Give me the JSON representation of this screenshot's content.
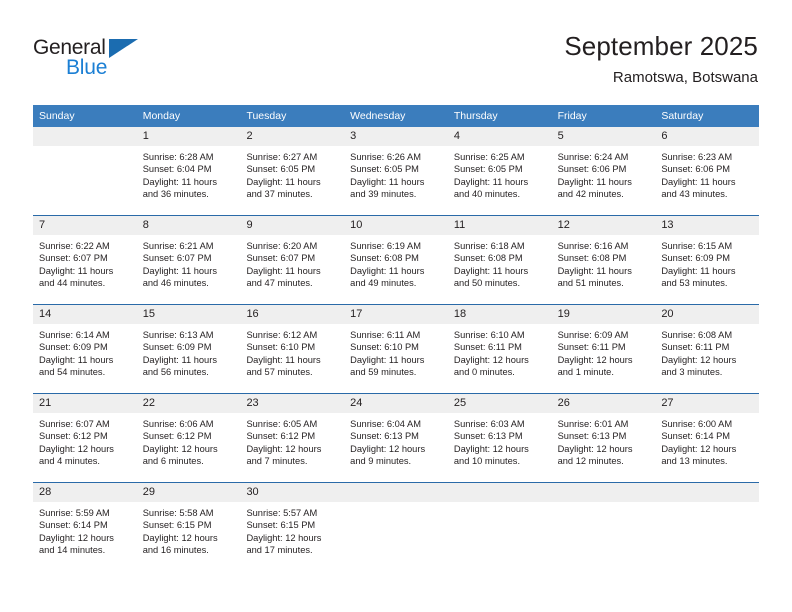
{
  "brand": {
    "name_dark": "General",
    "name_light": "Blue",
    "triangle_color": "#1b6cb0",
    "blue_color": "#1b7fd4"
  },
  "header": {
    "title": "September 2025",
    "subtitle": "Ramotswa, Botswana"
  },
  "calendar": {
    "header_bg": "#3b7dbd",
    "separator_color": "#2a6aa8",
    "daynum_bg": "#efefef",
    "weekdays": [
      "Sunday",
      "Monday",
      "Tuesday",
      "Wednesday",
      "Thursday",
      "Friday",
      "Saturday"
    ],
    "weeks": [
      [
        {
          "day": "",
          "l1": "",
          "l2": "",
          "l3": "",
          "l4": ""
        },
        {
          "day": "1",
          "l1": "Sunrise: 6:28 AM",
          "l2": "Sunset: 6:04 PM",
          "l3": "Daylight: 11 hours",
          "l4": "and 36 minutes."
        },
        {
          "day": "2",
          "l1": "Sunrise: 6:27 AM",
          "l2": "Sunset: 6:05 PM",
          "l3": "Daylight: 11 hours",
          "l4": "and 37 minutes."
        },
        {
          "day": "3",
          "l1": "Sunrise: 6:26 AM",
          "l2": "Sunset: 6:05 PM",
          "l3": "Daylight: 11 hours",
          "l4": "and 39 minutes."
        },
        {
          "day": "4",
          "l1": "Sunrise: 6:25 AM",
          "l2": "Sunset: 6:05 PM",
          "l3": "Daylight: 11 hours",
          "l4": "and 40 minutes."
        },
        {
          "day": "5",
          "l1": "Sunrise: 6:24 AM",
          "l2": "Sunset: 6:06 PM",
          "l3": "Daylight: 11 hours",
          "l4": "and 42 minutes."
        },
        {
          "day": "6",
          "l1": "Sunrise: 6:23 AM",
          "l2": "Sunset: 6:06 PM",
          "l3": "Daylight: 11 hours",
          "l4": "and 43 minutes."
        }
      ],
      [
        {
          "day": "7",
          "l1": "Sunrise: 6:22 AM",
          "l2": "Sunset: 6:07 PM",
          "l3": "Daylight: 11 hours",
          "l4": "and 44 minutes."
        },
        {
          "day": "8",
          "l1": "Sunrise: 6:21 AM",
          "l2": "Sunset: 6:07 PM",
          "l3": "Daylight: 11 hours",
          "l4": "and 46 minutes."
        },
        {
          "day": "9",
          "l1": "Sunrise: 6:20 AM",
          "l2": "Sunset: 6:07 PM",
          "l3": "Daylight: 11 hours",
          "l4": "and 47 minutes."
        },
        {
          "day": "10",
          "l1": "Sunrise: 6:19 AM",
          "l2": "Sunset: 6:08 PM",
          "l3": "Daylight: 11 hours",
          "l4": "and 49 minutes."
        },
        {
          "day": "11",
          "l1": "Sunrise: 6:18 AM",
          "l2": "Sunset: 6:08 PM",
          "l3": "Daylight: 11 hours",
          "l4": "and 50 minutes."
        },
        {
          "day": "12",
          "l1": "Sunrise: 6:16 AM",
          "l2": "Sunset: 6:08 PM",
          "l3": "Daylight: 11 hours",
          "l4": "and 51 minutes."
        },
        {
          "day": "13",
          "l1": "Sunrise: 6:15 AM",
          "l2": "Sunset: 6:09 PM",
          "l3": "Daylight: 11 hours",
          "l4": "and 53 minutes."
        }
      ],
      [
        {
          "day": "14",
          "l1": "Sunrise: 6:14 AM",
          "l2": "Sunset: 6:09 PM",
          "l3": "Daylight: 11 hours",
          "l4": "and 54 minutes."
        },
        {
          "day": "15",
          "l1": "Sunrise: 6:13 AM",
          "l2": "Sunset: 6:09 PM",
          "l3": "Daylight: 11 hours",
          "l4": "and 56 minutes."
        },
        {
          "day": "16",
          "l1": "Sunrise: 6:12 AM",
          "l2": "Sunset: 6:10 PM",
          "l3": "Daylight: 11 hours",
          "l4": "and 57 minutes."
        },
        {
          "day": "17",
          "l1": "Sunrise: 6:11 AM",
          "l2": "Sunset: 6:10 PM",
          "l3": "Daylight: 11 hours",
          "l4": "and 59 minutes."
        },
        {
          "day": "18",
          "l1": "Sunrise: 6:10 AM",
          "l2": "Sunset: 6:11 PM",
          "l3": "Daylight: 12 hours",
          "l4": "and 0 minutes."
        },
        {
          "day": "19",
          "l1": "Sunrise: 6:09 AM",
          "l2": "Sunset: 6:11 PM",
          "l3": "Daylight: 12 hours",
          "l4": "and 1 minute."
        },
        {
          "day": "20",
          "l1": "Sunrise: 6:08 AM",
          "l2": "Sunset: 6:11 PM",
          "l3": "Daylight: 12 hours",
          "l4": "and 3 minutes."
        }
      ],
      [
        {
          "day": "21",
          "l1": "Sunrise: 6:07 AM",
          "l2": "Sunset: 6:12 PM",
          "l3": "Daylight: 12 hours",
          "l4": "and 4 minutes."
        },
        {
          "day": "22",
          "l1": "Sunrise: 6:06 AM",
          "l2": "Sunset: 6:12 PM",
          "l3": "Daylight: 12 hours",
          "l4": "and 6 minutes."
        },
        {
          "day": "23",
          "l1": "Sunrise: 6:05 AM",
          "l2": "Sunset: 6:12 PM",
          "l3": "Daylight: 12 hours",
          "l4": "and 7 minutes."
        },
        {
          "day": "24",
          "l1": "Sunrise: 6:04 AM",
          "l2": "Sunset: 6:13 PM",
          "l3": "Daylight: 12 hours",
          "l4": "and 9 minutes."
        },
        {
          "day": "25",
          "l1": "Sunrise: 6:03 AM",
          "l2": "Sunset: 6:13 PM",
          "l3": "Daylight: 12 hours",
          "l4": "and 10 minutes."
        },
        {
          "day": "26",
          "l1": "Sunrise: 6:01 AM",
          "l2": "Sunset: 6:13 PM",
          "l3": "Daylight: 12 hours",
          "l4": "and 12 minutes."
        },
        {
          "day": "27",
          "l1": "Sunrise: 6:00 AM",
          "l2": "Sunset: 6:14 PM",
          "l3": "Daylight: 12 hours",
          "l4": "and 13 minutes."
        }
      ],
      [
        {
          "day": "28",
          "l1": "Sunrise: 5:59 AM",
          "l2": "Sunset: 6:14 PM",
          "l3": "Daylight: 12 hours",
          "l4": "and 14 minutes."
        },
        {
          "day": "29",
          "l1": "Sunrise: 5:58 AM",
          "l2": "Sunset: 6:15 PM",
          "l3": "Daylight: 12 hours",
          "l4": "and 16 minutes."
        },
        {
          "day": "30",
          "l1": "Sunrise: 5:57 AM",
          "l2": "Sunset: 6:15 PM",
          "l3": "Daylight: 12 hours",
          "l4": "and 17 minutes."
        },
        {
          "day": "",
          "l1": "",
          "l2": "",
          "l3": "",
          "l4": ""
        },
        {
          "day": "",
          "l1": "",
          "l2": "",
          "l3": "",
          "l4": ""
        },
        {
          "day": "",
          "l1": "",
          "l2": "",
          "l3": "",
          "l4": ""
        },
        {
          "day": "",
          "l1": "",
          "l2": "",
          "l3": "",
          "l4": ""
        }
      ]
    ]
  }
}
